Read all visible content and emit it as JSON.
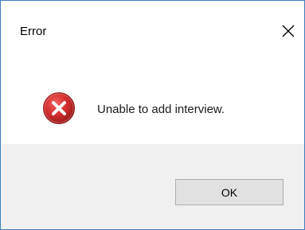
{
  "window": {
    "title": "Error",
    "close_icon": "close-icon"
  },
  "content": {
    "icon": "error-icon",
    "message": "Unable to add interview."
  },
  "footer": {
    "ok_label": "OK"
  },
  "colors": {
    "border": "#3f7fbf",
    "footer_bg": "#f0f0f0",
    "button_bg": "#e1e1e1",
    "button_border": "#adadad",
    "error_red": "#c62828"
  }
}
